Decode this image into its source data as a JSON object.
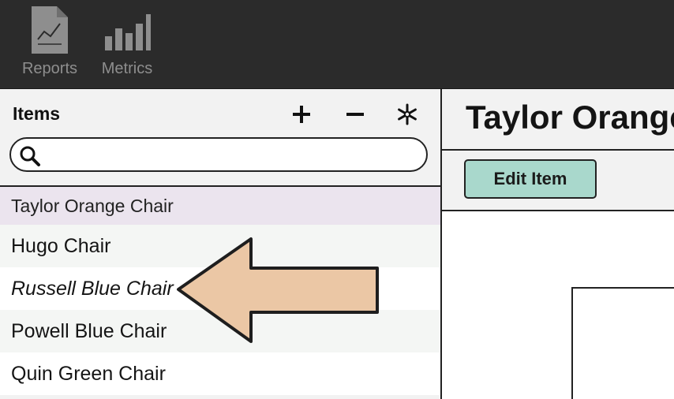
{
  "toolbar": {
    "items": [
      {
        "label": "Reports",
        "icon": "report-document-icon"
      },
      {
        "label": "Metrics",
        "icon": "bar-chart-icon"
      }
    ]
  },
  "left_panel": {
    "title": "Items",
    "buttons": {
      "add": "+",
      "remove": "−",
      "settings_icon": "asterisk-icon"
    },
    "search": {
      "value": "",
      "placeholder": ""
    },
    "items": [
      {
        "label": "Taylor Orange Chair",
        "selected": true
      },
      {
        "label": "Hugo Chair"
      },
      {
        "label": "Russell Blue Chair",
        "italic": true
      },
      {
        "label": "Powell Blue Chair"
      },
      {
        "label": "Quin Green Chair"
      }
    ]
  },
  "detail": {
    "title": "Taylor Orange Chair",
    "edit_button": "Edit Item"
  },
  "annotation": {
    "arrow_color": "#ebc7a5",
    "points_to": "Russell Blue Chair"
  },
  "colors": {
    "toolbar_bg": "#2b2b2b",
    "selected_row": "#ebe4ee",
    "edit_button": "#a9d8cc"
  }
}
